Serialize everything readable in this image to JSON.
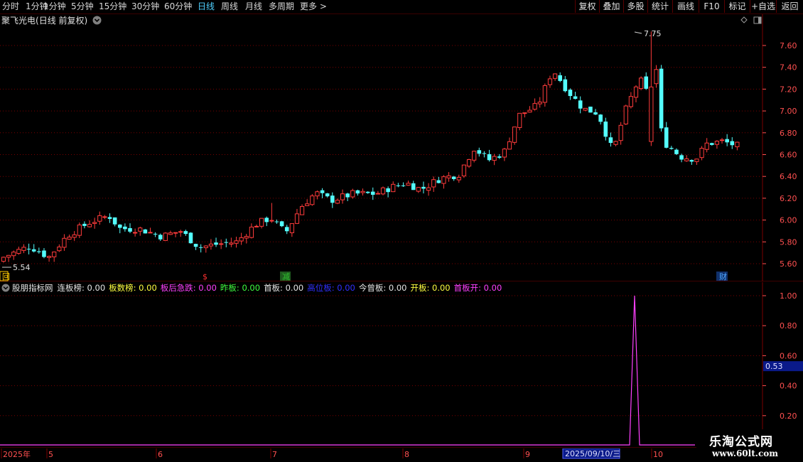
{
  "toolbar": {
    "periods": [
      "分时",
      "1分钟",
      "5分钟",
      "15分钟",
      "30分钟",
      "60分钟",
      "日线",
      "周线",
      "月线",
      "多周期",
      "更多"
    ],
    "active_period": "日线",
    "more_arrow": ">",
    "right_buttons": [
      "复权",
      "叠加",
      "多股",
      "统计",
      "画线",
      "F10",
      "标记",
      "+自选",
      "返回"
    ]
  },
  "title": {
    "stock_name": "聚飞光电",
    "period_note": "(日线 前复权)",
    "dropdown_icon": "chevron-down-circle-icon"
  },
  "price_axis": {
    "ticks": [
      "7.60",
      "7.40",
      "7.20",
      "7.00",
      "6.80",
      "6.60",
      "6.40",
      "6.20",
      "6.00",
      "5.80",
      "5.60"
    ]
  },
  "annotations": {
    "high_label": "7.75",
    "low_label": "5.54",
    "markers": [
      {
        "text": "回",
        "color": "#ffcc00"
      },
      {
        "text": "$",
        "color": "#ff3030"
      },
      {
        "text": "减",
        "color": "#30c030"
      },
      {
        "text": "财",
        "color": "#4fa8ff"
      }
    ]
  },
  "indicator": {
    "name": "股朋指标网",
    "items": [
      {
        "label": "连板榜:",
        "value": "0.00",
        "color": "#e6e6e6"
      },
      {
        "label": "板数榜:",
        "value": "0.00",
        "color": "#ffff40"
      },
      {
        "label": "板后急跌:",
        "value": "0.00",
        "color": "#ff40ff"
      },
      {
        "label": "昨板:",
        "value": "0.00",
        "color": "#40ff40"
      },
      {
        "label": "首板:",
        "value": "0.00",
        "color": "#e6e6e6"
      },
      {
        "label": "高位板:",
        "value": "0.00",
        "color": "#3030ff"
      },
      {
        "label": "今曾板:",
        "value": "0.00",
        "color": "#e6e6e6"
      },
      {
        "label": "开板:",
        "value": "0.00",
        "color": "#ffff40"
      },
      {
        "label": "首板开:",
        "value": "0.00",
        "color": "#ff40ff"
      }
    ],
    "ticks": [
      "1.00",
      "0.80",
      "0.60",
      "0.40",
      "0.20"
    ],
    "current_value": "0.53"
  },
  "date_axis": {
    "labels": [
      "2025年",
      "5",
      "6",
      "7",
      "8",
      "9",
      "10"
    ],
    "cursor_date": "2025/09/10/三"
  },
  "watermark": {
    "title": "乐淘公式网",
    "url": "www.60lt.com"
  },
  "colors": {
    "up": "#ff3b3b",
    "down": "#54ffff",
    "grid": "#7a0000",
    "axis_text": "#ff5050",
    "indicator_line": "#ff40ff"
  },
  "chart_data": {
    "type": "candlestick",
    "x_range": [
      "2025-04",
      "2025-10"
    ],
    "ylim": [
      5.5,
      7.7
    ],
    "high": 7.75,
    "low": 5.54,
    "indicator_series": {
      "name": "股朋指标网",
      "ylim": [
        0,
        1.05
      ],
      "spike_value": 1.0
    }
  }
}
